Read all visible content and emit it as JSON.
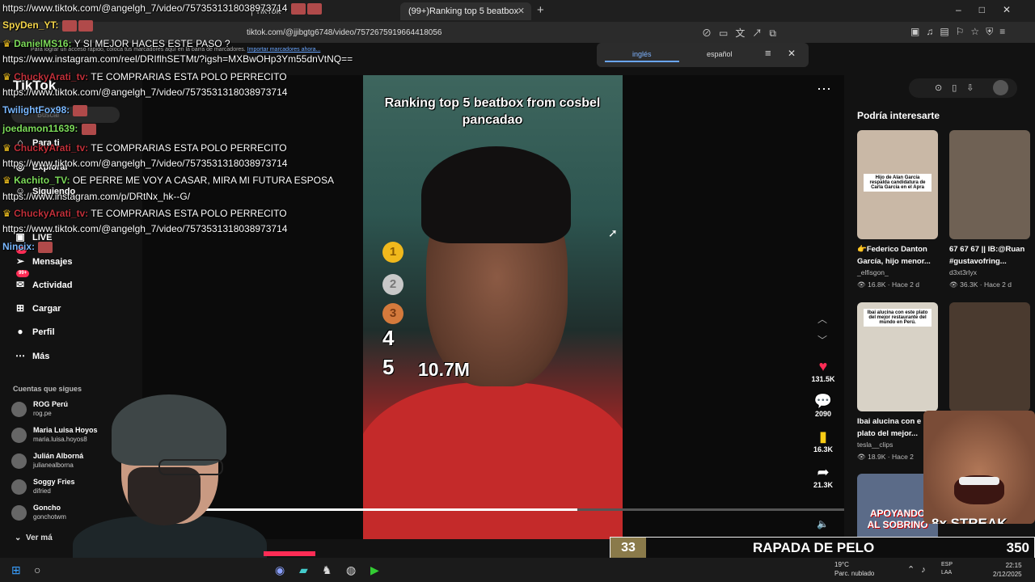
{
  "browser": {
    "tabs": [
      {
        "label": "| TikTok",
        "active": false
      },
      {
        "label": "(99+)Ranking top 5 beatbox",
        "active": true
      }
    ],
    "url": "tiktok.com/@jjibgtg6748/video/7572675919664418056",
    "bookmark_message": "Para lograr un acceso rápido, coloca tus marcadores aquí en la barra de marcadores.",
    "bookmark_link": "Importar marcadores ahora...",
    "translate": {
      "lang1": "inglés",
      "lang2": "español"
    }
  },
  "tiktok": {
    "logo": "TikTok",
    "search_placeholder": "Buscar",
    "nav": [
      {
        "label": "Para ti",
        "icon": "home-icon"
      },
      {
        "label": "Explorar",
        "icon": "compass-icon"
      },
      {
        "label": "Siguiendo",
        "icon": "users-icon"
      },
      {
        "label": "LIVE",
        "icon": "live-icon"
      },
      {
        "label": "Mensajes",
        "icon": "message-icon",
        "badge": "10"
      },
      {
        "label": "Actividad",
        "icon": "bell-icon",
        "badge": "99+"
      },
      {
        "label": "Cargar",
        "icon": "upload-icon"
      },
      {
        "label": "Perfil",
        "icon": "profile-icon"
      },
      {
        "label": "Más",
        "icon": "more-icon"
      }
    ],
    "following_title": "Cuentas que sigues",
    "following": [
      {
        "name": "ROG Perú",
        "handle": "rog.pe"
      },
      {
        "name": "Maria Luisa Hoyos",
        "handle": "maria.luisa.hoyos8"
      },
      {
        "name": "Julián Alborná",
        "handle": "julianealborna"
      },
      {
        "name": "Soggy Fries",
        "handle": "difried"
      },
      {
        "name": "Goncho",
        "handle": "gonchotwm"
      }
    ],
    "ver_mas": "Ver má",
    "video": {
      "title": "Ranking top 5 beatbox from cosbel pancadao",
      "ranks": [
        "4",
        "5"
      ],
      "medals": [
        "1",
        "2",
        "3"
      ],
      "views": "10.7M",
      "progress": 0.62
    },
    "actions": {
      "likes": "131.5K",
      "comments": "2090",
      "saves": "16.3K",
      "shares": "21.3K"
    },
    "right_panel": {
      "title": "Podría interesarte",
      "cards": [
        {
          "caption": "Hijo de Alan García respalda candidatura de Carla García en el Apra",
          "desc": "👉Federico Danton García, hijo menor...",
          "author": "_elfisgon_",
          "views": "16.8K",
          "time": "Hace 2 d",
          "color": "#c9b8a6"
        },
        {
          "caption": "",
          "desc": "67 67 67 || IB:@Ruan #gustavofring...",
          "author": "d3xt3rlyx",
          "views": "36.3K",
          "time": "Hace 2 d",
          "color": "#6f6154"
        },
        {
          "caption": "Ibai alucina con este plato del mejor restaurante del mundo en Perú.",
          "desc": "Ibai alucina con e plato del mejor...",
          "author": "tesla__clips",
          "views": "18.9K",
          "time": "Hace 2",
          "color": "#d8d2c6"
        },
        {
          "caption": "",
          "desc": "",
          "author": "",
          "views": "",
          "time": "",
          "color": "#4a3a2f"
        },
        {
          "caption": "APOYANDO AL SOBRINO",
          "desc": "",
          "author": "",
          "views": "",
          "time": "",
          "color": "#5b6b88"
        }
      ]
    }
  },
  "stream": {
    "chat": [
      {
        "user": "",
        "text": "https://www.tiktok.com/@angelgh_7/video/7573531318038973714",
        "color": "#ffffff"
      },
      {
        "user": "SpyDen_YT:",
        "text": "",
        "color": "#f5d64b"
      },
      {
        "user": "DanielMS16:",
        "text": "Y SI MEJOR HACES ESTE PASO ?",
        "color": "#7ddc5a"
      },
      {
        "user": "",
        "text": "https://www.instagram.com/reel/DRIflhSETMt/?igsh=MXBwOHp3Ym55dnVtNQ==",
        "color": "#ffffff"
      },
      {
        "user": "ChuckyArati_tv:",
        "text": "TE COMPRARIAS ESTA POLO PERRECITO",
        "color": "#c0303a"
      },
      {
        "user": "",
        "text": "https://www.tiktok.com/@angelgh_7/video/7573531318038973714",
        "color": "#ffffff"
      },
      {
        "user": "TwilightFox98:",
        "text": "",
        "color": "#7ab8ff"
      },
      {
        "user": "joedamon11639:",
        "text": "",
        "color": "#7ddc5a"
      },
      {
        "user": "ChuckyArati_tv:",
        "text": "TE COMPRARIAS ESTA POLO PERRECITO",
        "color": "#c0303a"
      },
      {
        "user": "",
        "text": "https://www.tiktok.com/@angelgh_7/video/7573531318038973714",
        "color": "#ffffff"
      },
      {
        "user": "Kachito_TV:",
        "text": "OE PERRE ME VOY A CASAR, MIRA MI FUTURA ESPOSA",
        "color": "#7ddc5a"
      },
      {
        "user": "",
        "text": "https://www.instagram.com/p/DRtNx_hk--G/",
        "color": "#ffffff"
      },
      {
        "user": "ChuckyArati_tv:",
        "text": "TE COMPRARIAS ESTA POLO PERRECITO",
        "color": "#c0303a"
      },
      {
        "user": "",
        "text": "https://www.tiktok.com/@angelgh_7/video/7573531318038973714",
        "color": "#ffffff"
      },
      {
        "user": "Nincix:",
        "text": "",
        "color": "#7ab8ff"
      }
    ],
    "meme_label": "8x STREAK",
    "bar": {
      "left_number": "33",
      "label": "RAPADA DE PELO",
      "right_number": "350"
    }
  },
  "taskbar": {
    "weather_temp": "19°C",
    "weather_desc": "Parc. nublado",
    "lang_top": "ESP",
    "lang_bottom": "LAA",
    "time": "22:15",
    "date": "2/12/2025"
  }
}
